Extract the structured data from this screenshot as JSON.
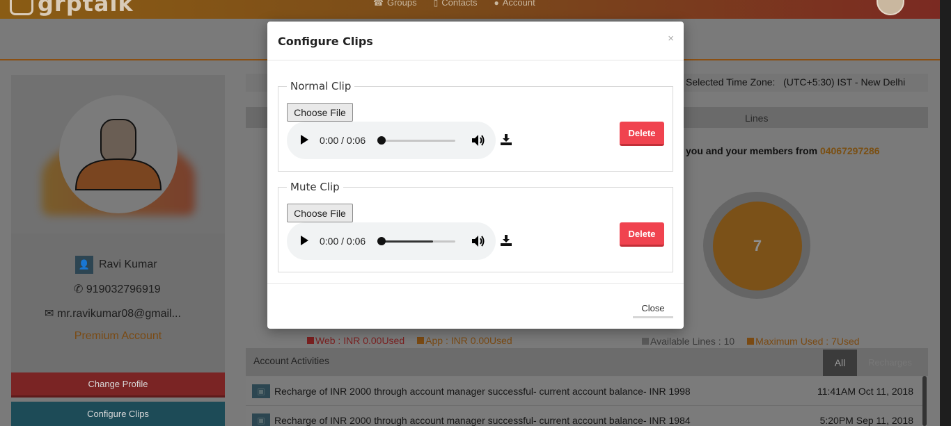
{
  "brand": {
    "name": "grptalk"
  },
  "nav": {
    "groups": "Groups",
    "contacts": "Contacts",
    "account": "Account"
  },
  "profile": {
    "name": "Ravi Kumar",
    "phone": "919032796919",
    "email": "mr.ravikumar08@gmail...",
    "account_type": "Premium Account",
    "change_profile": "Change Profile",
    "configure_clips": "Configure Clips"
  },
  "timezone": {
    "label": "Selected Time Zone:",
    "value": "(UTC+5:30) IST - New Delhi"
  },
  "lines": {
    "header": "Lines",
    "members_text": "you and your members from",
    "number": "04067297286",
    "count": "7",
    "legend_available": "Available Lines : 10",
    "legend_max": "Maximum Used : 7Used"
  },
  "usage": {
    "web": "Web : INR 0.00Used",
    "app": "App : INR 0.00Used"
  },
  "activities": {
    "title": "Account Activities",
    "tab_all": "All",
    "tab_recharges": "Recharges",
    "rows": [
      {
        "text": "Recharge of INR 2000 through account manager successful- current account balance- INR 1998",
        "time": "11:41AM Oct 11, 2018"
      },
      {
        "text": "Recharge of INR 2000 through account manager successful- current account balance- INR 1984",
        "time": "5:20PM Sep 11, 2018"
      }
    ]
  },
  "modal": {
    "title": "Configure Clips",
    "close_x": "×",
    "normal_clip": {
      "legend": "Normal Clip",
      "choose_file": "Choose File",
      "time": "0:00 / 0:06",
      "volume_level": 0.0,
      "delete": "Delete"
    },
    "mute_clip": {
      "legend": "Mute Clip",
      "choose_file": "Choose File",
      "time": "0:00 / 0:06",
      "volume_level": 0.7,
      "delete": "Delete"
    },
    "close": "Close"
  },
  "colors": {
    "delete_red": "#f0434f",
    "accent_orange": "#f0a23a",
    "overlay": "#7a7a7a"
  }
}
